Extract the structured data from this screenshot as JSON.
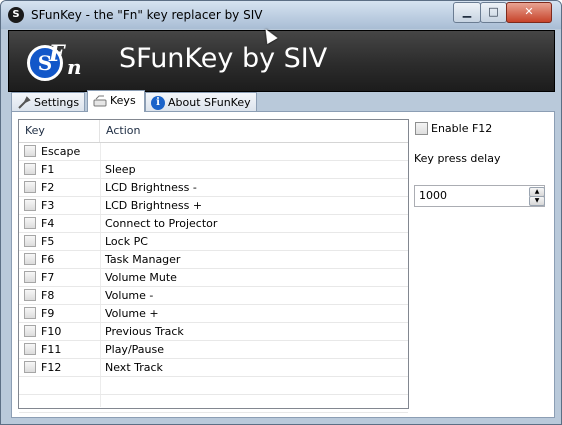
{
  "window": {
    "title": "SFunKey - the \"Fn\" key replacer by SIV",
    "app_icon_glyph": "S",
    "minimize_glyph": "▁",
    "maximize_glyph": "□",
    "close_glyph": "✕"
  },
  "banner": {
    "logo_s": "S",
    "logo_f": "F",
    "logo_n": "n",
    "title": "SFunKey by SIV"
  },
  "tabs": [
    {
      "label": "Settings",
      "icon": "wrench-icon"
    },
    {
      "label": "Keys",
      "icon": "keys-icon"
    },
    {
      "label": "About SFunKey",
      "icon": "info-icon"
    }
  ],
  "active_tab": "Keys",
  "key_list": {
    "columns": [
      "Key",
      "Action"
    ],
    "rows": [
      {
        "key": "Escape",
        "action": ""
      },
      {
        "key": "F1",
        "action": "Sleep"
      },
      {
        "key": "F2",
        "action": "LCD Brightness -"
      },
      {
        "key": "F3",
        "action": "LCD Brightness +"
      },
      {
        "key": "F4",
        "action": "Connect to Projector"
      },
      {
        "key": "F5",
        "action": "Lock PC"
      },
      {
        "key": "F6",
        "action": "Task Manager"
      },
      {
        "key": "F7",
        "action": "Volume Mute"
      },
      {
        "key": "F8",
        "action": "Volume -"
      },
      {
        "key": "F9",
        "action": "Volume +"
      },
      {
        "key": "F10",
        "action": "Previous Track"
      },
      {
        "key": "F11",
        "action": "Play/Pause"
      },
      {
        "key": "F12",
        "action": "Next Track"
      }
    ]
  },
  "options": {
    "enable_f12_label": "Enable F12",
    "enable_f12_checked": false,
    "key_press_delay_label": "Key press delay",
    "key_press_delay_value": "1000",
    "spin_up_glyph": "▲",
    "spin_down_glyph": "▼"
  },
  "colors": {
    "banner_bg": "#2c2c2c",
    "logo_blue": "#1257c9",
    "close_red": "#c7432a",
    "title_bar": "#bfd0e3"
  }
}
